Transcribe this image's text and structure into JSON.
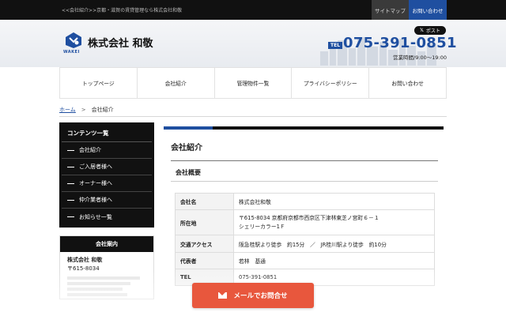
{
  "topbar": {
    "tagline": "<<会社紹介>>京都・滋賀の賃貸管理なら株式会社和敬",
    "sitemap_label": "サイトマップ",
    "contact_label": "お問い合わせ"
  },
  "header": {
    "logo_text": "WAKEI",
    "company_name": "株式会社 和敬",
    "post_label": "ポスト",
    "tel_badge": "TEL",
    "tel": "075-391-0851",
    "hours": "営業時間/9:00～19:00"
  },
  "nav": {
    "items": [
      "トップページ",
      "会社紹介",
      "管理物件一覧",
      "プライバシーポリシー",
      "お問い合わせ"
    ]
  },
  "breadcrumb": {
    "home": "ホーム",
    "separator": ">",
    "current": "会社紹介"
  },
  "sidebar": {
    "contents_title": "コンテンツ一覧",
    "contents_items": [
      "会社紹介",
      "ご入居者様へ",
      "オーナー様へ",
      "仲介業者様へ",
      "お知らせ一覧"
    ],
    "info_title": "会社案内",
    "info_name": "株式会社 和敬",
    "info_zip": "〒615-8034"
  },
  "main": {
    "heading": "会社紹介",
    "sub_heading": "会社概要",
    "table": [
      {
        "label": "会社名",
        "value": "株式会社和敬"
      },
      {
        "label": "所在地",
        "value": "〒615-8034 京都府京都市西京区下津林東芝ノ宮町６－１",
        "value2": "シェリーカラー1Ｆ"
      },
      {
        "label": "交通アクセス",
        "value": "阪急桂駅より徒歩　約15分　／　JR桂川駅より徒歩　約10分"
      },
      {
        "label": "代表者",
        "value": "若林　基通"
      },
      {
        "label": "TEL",
        "value": "075-391-0851"
      }
    ]
  },
  "fab": {
    "label": "メールでお問合せ",
    "icon": "mail-icon"
  },
  "colors": {
    "accent": "#1f4fa0",
    "cta": "#e8573d",
    "dark": "#111111"
  }
}
